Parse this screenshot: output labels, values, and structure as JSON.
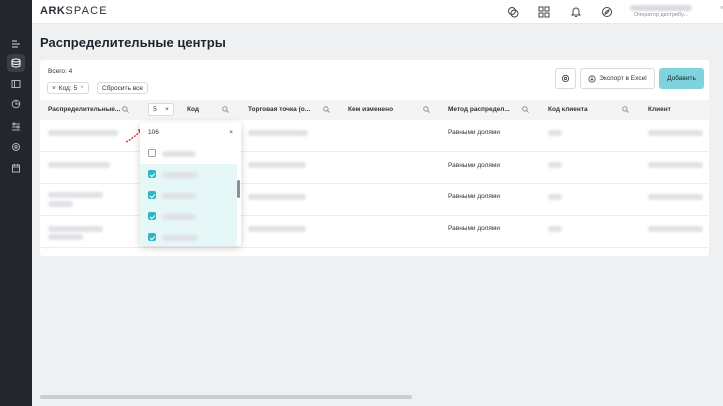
{
  "app": {
    "logo_bold": "ARK",
    "logo_thin": "SPACE"
  },
  "header": {
    "user_role": "Оператор дистрибу...",
    "user_menu": "˅"
  },
  "page": {
    "title": "Распределительные центры"
  },
  "toolbar": {
    "total_label": "Всего: 4",
    "chip_label": "Код: 5",
    "reset_label": "Сбросить все",
    "export_label": "Экспорт в Excel",
    "add_label": "Добавить"
  },
  "table": {
    "columns": [
      "Распределительные...",
      "Код",
      "Торговая точка (о...",
      "Кем изменено",
      "Метод распредел...",
      "Код клиента",
      "Клиент"
    ],
    "filter_value": "5",
    "rows": [
      {
        "method": "Равными долями"
      },
      {
        "method": "Равными долями"
      },
      {
        "method": "Равными долями"
      },
      {
        "method": "Равными долями"
      }
    ]
  },
  "dropdown": {
    "search_value": "106",
    "clear": "×",
    "items": [
      {
        "checked": false
      },
      {
        "checked": true
      },
      {
        "checked": true
      },
      {
        "checked": true
      },
      {
        "checked": true
      }
    ]
  },
  "icons": [
    "settings-icon",
    "download-icon",
    "search-icon",
    "close-icon",
    "bell-icon",
    "apps-icon",
    "compass-icon",
    "chat-icon"
  ],
  "colors": {
    "primary": "#7fd4dc",
    "checkbox": "#2db7c6",
    "sidebar": "#23262d",
    "arrow": "#d93030"
  }
}
